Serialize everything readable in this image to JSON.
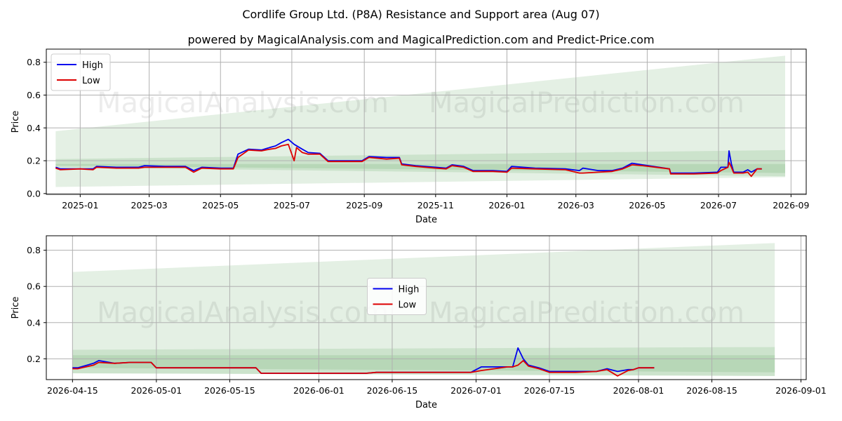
{
  "title_line1": "Cordlife Group Ltd. (P8A) Resistance and Support area (Aug 07)",
  "title_line2": "powered by MagicalAnalysis.com and MagicalPrediction.com and Predict-Price.com",
  "watermark_left": "MagicalAnalysis.com",
  "watermark_right": "MagicalPrediction.com",
  "colors": {
    "high": "#0000ee",
    "low": "#dd0000",
    "band": "#2e8b2e"
  },
  "chart_data": [
    {
      "type": "line",
      "xlabel": "Date",
      "ylabel": "Price",
      "xlim": [
        "2024-12-03",
        "2026-09-14"
      ],
      "ylim": [
        -0.005,
        0.88
      ],
      "x_ticks": [
        "2025-01",
        "2025-03",
        "2025-05",
        "2025-07",
        "2025-09",
        "2025-11",
        "2026-01",
        "2026-03",
        "2026-05",
        "2026-07",
        "2026-09"
      ],
      "y_ticks": [
        0.0,
        0.2,
        0.4,
        0.6,
        0.8
      ],
      "grid": true,
      "legend": "top-left",
      "bands": [
        {
          "x": [
            "2024-12-11",
            "2026-08-27"
          ],
          "upper": [
            0.38,
            0.84
          ],
          "lower": [
            0.04,
            0.1
          ]
        },
        {
          "x": [
            "2024-12-11",
            "2026-08-27"
          ],
          "upper": [
            0.21,
            0.265
          ],
          "lower": [
            0.16,
            0.105
          ]
        },
        {
          "x": [
            "2024-12-11",
            "2026-08-27"
          ],
          "upper": [
            0.18,
            0.18
          ],
          "lower": [
            0.17,
            0.125
          ]
        }
      ],
      "series": [
        {
          "name": "High",
          "points": [
            [
              "2024-12-11",
              0.16
            ],
            [
              "2024-12-15",
              0.15
            ],
            [
              "2025-01-01",
              0.15
            ],
            [
              "2025-01-12",
              0.15
            ],
            [
              "2025-01-15",
              0.165
            ],
            [
              "2025-02-01",
              0.16
            ],
            [
              "2025-02-20",
              0.16
            ],
            [
              "2025-02-25",
              0.17
            ],
            [
              "2025-03-15",
              0.165
            ],
            [
              "2025-04-01",
              0.165
            ],
            [
              "2025-04-08",
              0.14
            ],
            [
              "2025-04-15",
              0.16
            ],
            [
              "2025-05-01",
              0.155
            ],
            [
              "2025-05-12",
              0.155
            ],
            [
              "2025-05-16",
              0.24
            ],
            [
              "2025-05-25",
              0.27
            ],
            [
              "2025-06-05",
              0.265
            ],
            [
              "2025-06-12",
              0.28
            ],
            [
              "2025-06-17",
              0.29
            ],
            [
              "2025-06-22",
              0.31
            ],
            [
              "2025-06-28",
              0.33
            ],
            [
              "2025-07-03",
              0.3
            ],
            [
              "2025-07-10",
              0.27
            ],
            [
              "2025-07-15",
              0.25
            ],
            [
              "2025-07-25",
              0.245
            ],
            [
              "2025-08-01",
              0.2
            ],
            [
              "2025-08-12",
              0.2
            ],
            [
              "2025-08-30",
              0.2
            ],
            [
              "2025-09-05",
              0.225
            ],
            [
              "2025-09-20",
              0.22
            ],
            [
              "2025-10-01",
              0.22
            ],
            [
              "2025-10-03",
              0.18
            ],
            [
              "2025-10-15",
              0.17
            ],
            [
              "2025-11-01",
              0.16
            ],
            [
              "2025-11-10",
              0.155
            ],
            [
              "2025-11-15",
              0.175
            ],
            [
              "2025-11-25",
              0.165
            ],
            [
              "2025-12-03",
              0.14
            ],
            [
              "2025-12-20",
              0.14
            ],
            [
              "2026-01-01",
              0.135
            ],
            [
              "2026-01-05",
              0.165
            ],
            [
              "2026-01-25",
              0.155
            ],
            [
              "2026-02-20",
              0.15
            ],
            [
              "2026-03-04",
              0.14
            ],
            [
              "2026-03-07",
              0.155
            ],
            [
              "2026-03-20",
              0.14
            ],
            [
              "2026-04-01",
              0.14
            ],
            [
              "2026-04-10",
              0.155
            ],
            [
              "2026-04-18",
              0.185
            ],
            [
              "2026-04-27",
              0.175
            ],
            [
              "2026-05-20",
              0.15
            ],
            [
              "2026-05-21",
              0.125
            ],
            [
              "2026-06-10",
              0.125
            ],
            [
              "2026-06-30",
              0.13
            ],
            [
              "2026-07-03",
              0.16
            ],
            [
              "2026-07-09",
              0.16
            ],
            [
              "2026-07-10",
              0.26
            ],
            [
              "2026-07-12",
              0.18
            ],
            [
              "2026-07-14",
              0.13
            ],
            [
              "2026-07-22",
              0.13
            ],
            [
              "2026-07-26",
              0.145
            ],
            [
              "2026-07-29",
              0.13
            ],
            [
              "2026-08-03",
              0.15
            ],
            [
              "2026-08-07",
              0.15
            ]
          ]
        },
        {
          "name": "Low",
          "points": [
            [
              "2024-12-11",
              0.155
            ],
            [
              "2024-12-15",
              0.145
            ],
            [
              "2025-01-01",
              0.15
            ],
            [
              "2025-01-12",
              0.145
            ],
            [
              "2025-01-15",
              0.16
            ],
            [
              "2025-02-01",
              0.155
            ],
            [
              "2025-02-20",
              0.155
            ],
            [
              "2025-02-25",
              0.16
            ],
            [
              "2025-03-15",
              0.16
            ],
            [
              "2025-04-01",
              0.16
            ],
            [
              "2025-04-08",
              0.13
            ],
            [
              "2025-04-15",
              0.155
            ],
            [
              "2025-05-01",
              0.15
            ],
            [
              "2025-05-12",
              0.15
            ],
            [
              "2025-05-16",
              0.22
            ],
            [
              "2025-05-25",
              0.265
            ],
            [
              "2025-06-05",
              0.26
            ],
            [
              "2025-06-12",
              0.27
            ],
            [
              "2025-06-17",
              0.275
            ],
            [
              "2025-06-22",
              0.29
            ],
            [
              "2025-06-28",
              0.3
            ],
            [
              "2025-07-03",
              0.2
            ],
            [
              "2025-07-05",
              0.28
            ],
            [
              "2025-07-10",
              0.25
            ],
            [
              "2025-07-15",
              0.24
            ],
            [
              "2025-07-25",
              0.24
            ],
            [
              "2025-08-01",
              0.195
            ],
            [
              "2025-08-12",
              0.195
            ],
            [
              "2025-08-30",
              0.195
            ],
            [
              "2025-09-05",
              0.22
            ],
            [
              "2025-09-20",
              0.21
            ],
            [
              "2025-10-01",
              0.215
            ],
            [
              "2025-10-03",
              0.175
            ],
            [
              "2025-10-15",
              0.165
            ],
            [
              "2025-11-01",
              0.155
            ],
            [
              "2025-11-10",
              0.15
            ],
            [
              "2025-11-15",
              0.17
            ],
            [
              "2025-11-25",
              0.16
            ],
            [
              "2025-12-03",
              0.135
            ],
            [
              "2025-12-20",
              0.135
            ],
            [
              "2026-01-01",
              0.13
            ],
            [
              "2026-01-05",
              0.155
            ],
            [
              "2026-01-25",
              0.15
            ],
            [
              "2026-02-20",
              0.145
            ],
            [
              "2026-03-04",
              0.125
            ],
            [
              "2026-03-07",
              0.125
            ],
            [
              "2026-03-20",
              0.13
            ],
            [
              "2026-04-01",
              0.135
            ],
            [
              "2026-04-10",
              0.15
            ],
            [
              "2026-04-18",
              0.175
            ],
            [
              "2026-04-27",
              0.17
            ],
            [
              "2026-05-20",
              0.15
            ],
            [
              "2026-05-21",
              0.12
            ],
            [
              "2026-06-10",
              0.12
            ],
            [
              "2026-06-30",
              0.125
            ],
            [
              "2026-07-03",
              0.14
            ],
            [
              "2026-07-09",
              0.16
            ],
            [
              "2026-07-10",
              0.19
            ],
            [
              "2026-07-12",
              0.16
            ],
            [
              "2026-07-14",
              0.125
            ],
            [
              "2026-07-22",
              0.125
            ],
            [
              "2026-07-26",
              0.13
            ],
            [
              "2026-07-29",
              0.105
            ],
            [
              "2026-08-03",
              0.15
            ],
            [
              "2026-08-07",
              0.15
            ]
          ]
        }
      ]
    },
    {
      "type": "line",
      "xlabel": "Date",
      "ylabel": "Price",
      "xlim": [
        "2026-04-10",
        "2026-09-02"
      ],
      "ylim": [
        0.085,
        0.88
      ],
      "x_ticks": [
        "2026-04-15",
        "2026-05-01",
        "2026-05-15",
        "2026-06-01",
        "2026-06-15",
        "2026-07-01",
        "2026-07-15",
        "2026-08-01",
        "2026-08-15",
        "2026-09-01"
      ],
      "y_ticks": [
        0.2,
        0.4,
        0.6,
        0.8
      ],
      "grid": true,
      "legend": "center",
      "bands": [
        {
          "x": [
            "2026-04-15",
            "2026-08-27"
          ],
          "upper": [
            0.68,
            0.84
          ],
          "lower": [
            0.12,
            0.105
          ]
        },
        {
          "x": [
            "2026-04-15",
            "2026-08-27"
          ],
          "upper": [
            0.25,
            0.265
          ],
          "lower": [
            0.12,
            0.105
          ]
        },
        {
          "x": [
            "2026-04-15",
            "2026-08-27"
          ],
          "upper": [
            0.22,
            0.22
          ],
          "lower": [
            0.15,
            0.125
          ]
        }
      ],
      "series": [
        {
          "name": "High",
          "points": [
            [
              "2026-04-15",
              0.15
            ],
            [
              "2026-04-16",
              0.15
            ],
            [
              "2026-04-19",
              0.175
            ],
            [
              "2026-04-20",
              0.19
            ],
            [
              "2026-04-23",
              0.175
            ],
            [
              "2026-04-26",
              0.18
            ],
            [
              "2026-04-30",
              0.18
            ],
            [
              "2026-05-01",
              0.15
            ],
            [
              "2026-05-10",
              0.15
            ],
            [
              "2026-05-20",
              0.15
            ],
            [
              "2026-05-21",
              0.12
            ],
            [
              "2026-06-10",
              0.12
            ],
            [
              "2026-06-12",
              0.125
            ],
            [
              "2026-06-30",
              0.125
            ],
            [
              "2026-07-02",
              0.155
            ],
            [
              "2026-07-07",
              0.155
            ],
            [
              "2026-07-08",
              0.155
            ],
            [
              "2026-07-09",
              0.26
            ],
            [
              "2026-07-10",
              0.2
            ],
            [
              "2026-07-11",
              0.165
            ],
            [
              "2026-07-13",
              0.15
            ],
            [
              "2026-07-15",
              0.13
            ],
            [
              "2026-07-20",
              0.13
            ],
            [
              "2026-07-24",
              0.13
            ],
            [
              "2026-07-26",
              0.145
            ],
            [
              "2026-07-28",
              0.13
            ],
            [
              "2026-07-30",
              0.14
            ],
            [
              "2026-07-31",
              0.14
            ],
            [
              "2026-08-01",
              0.15
            ],
            [
              "2026-08-04",
              0.15
            ]
          ]
        },
        {
          "name": "Low",
          "points": [
            [
              "2026-04-15",
              0.145
            ],
            [
              "2026-04-16",
              0.145
            ],
            [
              "2026-04-19",
              0.165
            ],
            [
              "2026-04-20",
              0.18
            ],
            [
              "2026-04-23",
              0.175
            ],
            [
              "2026-04-26",
              0.18
            ],
            [
              "2026-04-30",
              0.18
            ],
            [
              "2026-05-01",
              0.15
            ],
            [
              "2026-05-10",
              0.15
            ],
            [
              "2026-05-20",
              0.15
            ],
            [
              "2026-05-21",
              0.12
            ],
            [
              "2026-06-10",
              0.12
            ],
            [
              "2026-06-12",
              0.125
            ],
            [
              "2026-06-30",
              0.125
            ],
            [
              "2026-07-02",
              0.135
            ],
            [
              "2026-07-07",
              0.155
            ],
            [
              "2026-07-08",
              0.155
            ],
            [
              "2026-07-09",
              0.165
            ],
            [
              "2026-07-10",
              0.19
            ],
            [
              "2026-07-11",
              0.16
            ],
            [
              "2026-07-13",
              0.145
            ],
            [
              "2026-07-15",
              0.125
            ],
            [
              "2026-07-20",
              0.125
            ],
            [
              "2026-07-24",
              0.13
            ],
            [
              "2026-07-26",
              0.14
            ],
            [
              "2026-07-28",
              0.105
            ],
            [
              "2026-07-30",
              0.135
            ],
            [
              "2026-07-31",
              0.14
            ],
            [
              "2026-08-01",
              0.15
            ],
            [
              "2026-08-04",
              0.15
            ]
          ]
        }
      ]
    }
  ]
}
